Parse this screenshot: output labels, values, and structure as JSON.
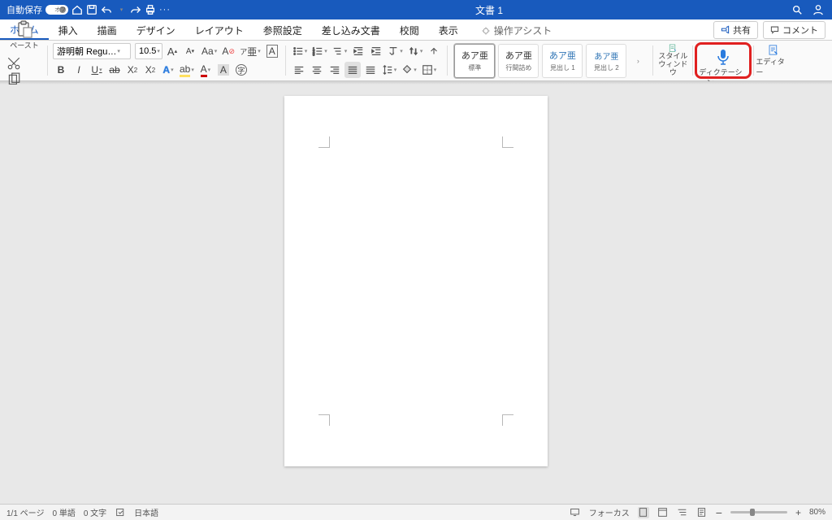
{
  "titlebar": {
    "autosave_label": "自動保存",
    "autosave_state": "オフ",
    "doc_title": "文書 1"
  },
  "tabs": {
    "home": "ホーム",
    "insert": "挿入",
    "drawing": "描画",
    "design": "デザイン",
    "layout": "レイアウト",
    "references": "参照設定",
    "mailmerge": "差し込み文書",
    "review": "校閲",
    "view": "表示",
    "tell_me": "操作アシスト"
  },
  "ribbon_actions": {
    "share": "共有",
    "comments": "コメント"
  },
  "ribbon": {
    "paste": "ペースト",
    "font_name": "游明朝 Regu…",
    "font_size": "10.5",
    "increase_font": "A",
    "decrease_font": "A",
    "change_case": "Aa",
    "clear_format": "A",
    "phonetic": "A",
    "char_border": "A",
    "bold": "B",
    "italic": "I",
    "underline": "U",
    "strike": "ab",
    "sub": "X₂",
    "sup": "X²",
    "font_color": "A",
    "text_effects": "A",
    "highlight": "A",
    "char_shading": "A",
    "style_sample": "あア亜",
    "styles": {
      "normal": "標準",
      "no_spacing": "行間詰め",
      "heading1": "見出し 1",
      "heading2": "見出し 2"
    },
    "styles_pane": "スタイル\nウィンドウ",
    "dictation": "ディクテーション",
    "editor": "エディター"
  },
  "status": {
    "page": "1/1 ページ",
    "word_count": "0 単語",
    "char_count": "0 文字",
    "language": "日本語",
    "focus": "フォーカス",
    "zoom": "80%"
  },
  "icons": {
    "home": "home-icon",
    "save": "save-icon",
    "undo": "undo-icon",
    "redo": "redo-icon",
    "print": "print-icon"
  }
}
